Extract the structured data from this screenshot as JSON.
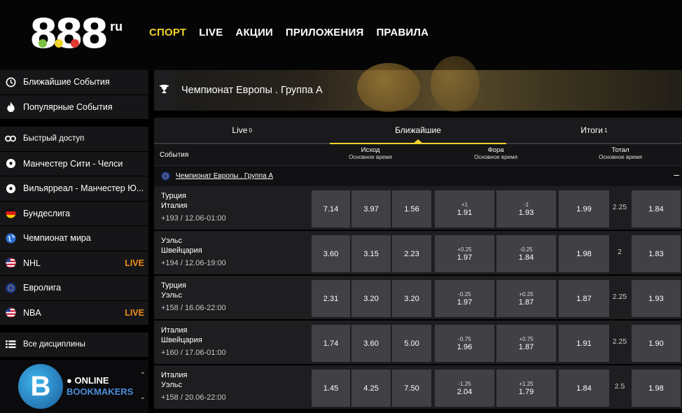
{
  "header": {
    "logo_text": "888",
    "logo_suffix": "ru",
    "logo_dot_colors": [
      "#7cc242",
      "#f0d32b",
      "#e53935"
    ],
    "nav": [
      {
        "label": "СПОРТ",
        "active": true
      },
      {
        "label": "LIVE",
        "active": false
      },
      {
        "label": "АКЦИИ",
        "active": false
      },
      {
        "label": "ПРИЛОЖЕНИЯ",
        "active": false
      },
      {
        "label": "ПРАВИЛА",
        "active": false
      }
    ]
  },
  "colors": {
    "accent": "#f0d32b",
    "live": "#f08a18",
    "odd_bg": "#414145"
  },
  "sidebar": {
    "group1": [
      {
        "label": "Ближайшие События",
        "icon": "clock-icon"
      },
      {
        "label": "Популярные События",
        "icon": "fire-icon"
      }
    ],
    "group2": [
      {
        "label": "Быстрый доступ",
        "icon": "link-icon"
      },
      {
        "label": "Манчестер Сити - Челси",
        "icon": "soccer-ball-icon"
      },
      {
        "label": "Вильярреал - Манчестер Ю...",
        "icon": "soccer-ball-icon"
      },
      {
        "label": "Бундеслига",
        "icon": "germany-flag-icon"
      },
      {
        "label": "Чемпионат мира",
        "icon": "globe-icon"
      },
      {
        "label": "NHL",
        "icon": "usa-flag-icon",
        "live": "LIVE"
      },
      {
        "label": "Евролига",
        "icon": "eu-flag-icon"
      },
      {
        "label": "NBA",
        "icon": "usa-flag-icon",
        "live": "LIVE"
      }
    ],
    "all_label": "Все дисциплины",
    "watermark": {
      "line1": "ONLINE",
      "line2": "BOOKMAKERS",
      "letter": "B"
    }
  },
  "main": {
    "banner_title": "Чемпионат Европы . Группа A",
    "tabs": [
      {
        "label": "Live",
        "count": "0",
        "active": false
      },
      {
        "label": "Ближайшие",
        "count": "",
        "active": true
      },
      {
        "label": "Итоги",
        "count": "1",
        "active": false
      }
    ],
    "columns": {
      "events": "События",
      "outcome": "Исход",
      "outcome_sub": "Основное время",
      "handicap": "Фора",
      "handicap_sub": "Основное время",
      "total": "Тотал",
      "total_sub": "Основное время"
    },
    "league": "Чемпионат Европы . Группа A",
    "collapse": "–",
    "matches": [
      {
        "team1": "Турция",
        "team2": "Италия",
        "meta": "+193 / 12.06-01:00",
        "o1": "7.14",
        "ox": "3.97",
        "o2": "1.56",
        "h1": "+1",
        "h1odd": "1.91",
        "h2": "-1",
        "h2odd": "1.93",
        "tover": "1.99",
        "tline": "2.25",
        "tunder": "1.84"
      },
      {
        "team1": "Уэльс",
        "team2": "Швейцария",
        "meta": "+194 / 12.06-19:00",
        "o1": "3.60",
        "ox": "3.15",
        "o2": "2.23",
        "h1": "+0.25",
        "h1odd": "1.97",
        "h2": "-0.25",
        "h2odd": "1.84",
        "tover": "1.98",
        "tline": "2",
        "tunder": "1.83"
      },
      {
        "team1": "Турция",
        "team2": "Уэльс",
        "meta": "+158 / 16.06-22:00",
        "o1": "2.31",
        "ox": "3.20",
        "o2": "3.20",
        "h1": "-0.25",
        "h1odd": "1.97",
        "h2": "+0.25",
        "h2odd": "1.87",
        "tover": "1.87",
        "tline": "2.25",
        "tunder": "1.93"
      },
      {
        "team1": "Италия",
        "team2": "Швейцария",
        "meta": "+160 / 17.06-01:00",
        "o1": "1.74",
        "ox": "3.60",
        "o2": "5.00",
        "h1": "-0.75",
        "h1odd": "1.96",
        "h2": "+0.75",
        "h2odd": "1.87",
        "tover": "1.91",
        "tline": "2.25",
        "tunder": "1.90"
      },
      {
        "team1": "Италия",
        "team2": "Уэльс",
        "meta": "+158 / 20.06-22:00",
        "o1": "1.45",
        "ox": "4.25",
        "o2": "7.50",
        "h1": "-1.25",
        "h1odd": "2.04",
        "h2": "+1.25",
        "h2odd": "1.79",
        "tover": "1.84",
        "tline": "2.5",
        "tunder": "1.98"
      }
    ]
  }
}
